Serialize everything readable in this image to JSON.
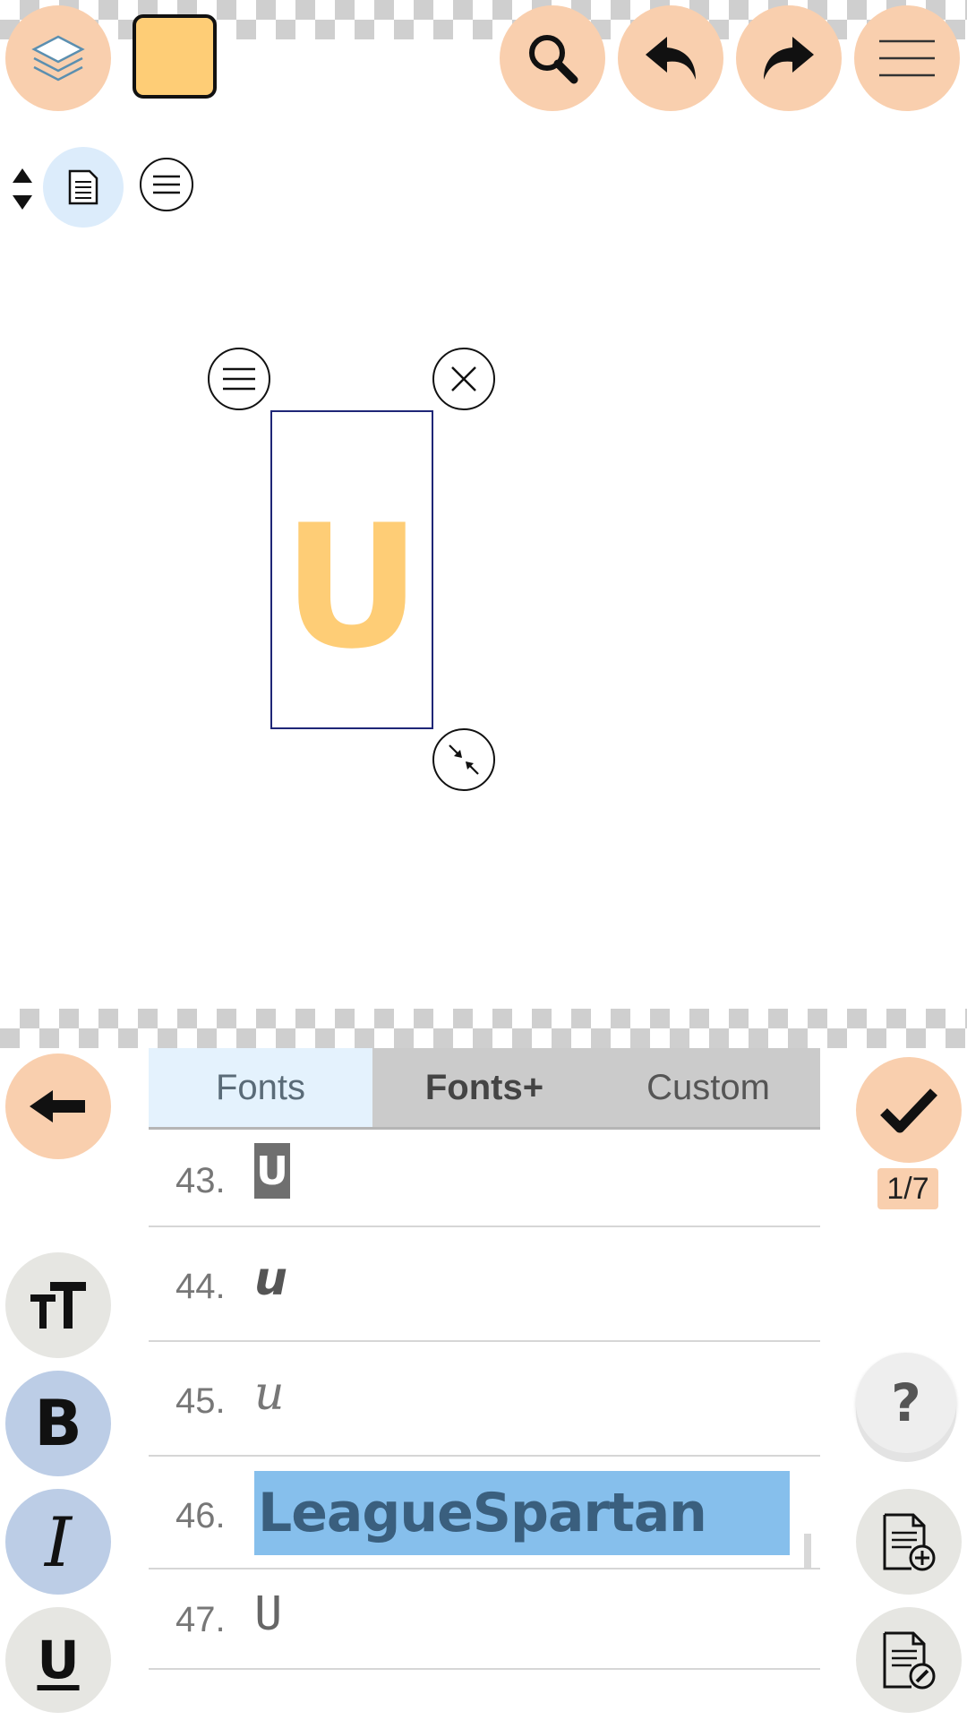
{
  "top_toolbar": {
    "layers_icon": "layers-icon",
    "color_swatch": "#fecd76",
    "search_icon": "search-icon",
    "undo_icon": "undo-icon",
    "redo_icon": "redo-icon",
    "menu_icon": "hamburger-menu-icon"
  },
  "canvas": {
    "selected_text": "U",
    "text_color": "#fecd76"
  },
  "font_panel": {
    "tabs": [
      {
        "label": "Fonts",
        "active": true
      },
      {
        "label": "Fonts+",
        "active": false
      },
      {
        "label": "Custom",
        "active": false
      }
    ],
    "fonts": [
      {
        "number": "43.",
        "sample": "U"
      },
      {
        "number": "44.",
        "sample": "u"
      },
      {
        "number": "45.",
        "sample": "u"
      },
      {
        "number": "46.",
        "sample": "LeagueSpartan",
        "selected": true
      },
      {
        "number": "47.",
        "sample": "U"
      }
    ]
  },
  "right_panel": {
    "page_indicator": "1/7",
    "help_label": "?"
  },
  "colors": {
    "accent": "#f9cfae",
    "selection": "#86bfec",
    "style_active": "#bccde6"
  }
}
